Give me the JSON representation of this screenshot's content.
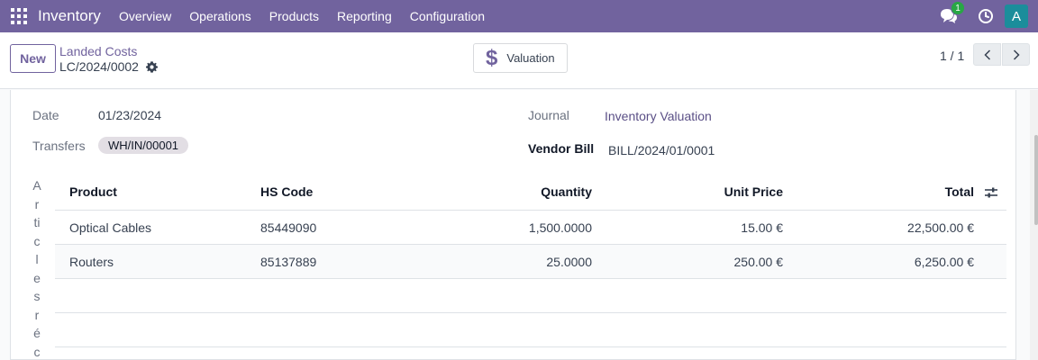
{
  "navbar": {
    "app_name": "Inventory",
    "menu": [
      "Overview",
      "Operations",
      "Products",
      "Reporting",
      "Configuration"
    ],
    "chat_badge": "1",
    "avatar_letter": "A"
  },
  "control_panel": {
    "new_label": "New",
    "breadcrumb_parent": "Landed Costs",
    "breadcrumb_current": "LC/2024/0002",
    "valuation_label": "Valuation",
    "pager": "1 / 1"
  },
  "form": {
    "date_label": "Date",
    "date_value": "01/23/2024",
    "transfers_label": "Transfers",
    "transfers_tag": "WH/IN/00001",
    "journal_label": "Journal",
    "journal_value": "Inventory Valuation",
    "vendor_bill_label": "Vendor Bill",
    "vendor_bill_value": "BILL/2024/01/0001",
    "vertical_label_chars": [
      "A",
      "r",
      "ti",
      "c",
      "l",
      "e",
      "s",
      "r",
      "é",
      "c"
    ]
  },
  "table": {
    "headers": {
      "product": "Product",
      "hs_code": "HS Code",
      "quantity": "Quantity",
      "unit_price": "Unit Price",
      "total": "Total"
    },
    "rows": [
      {
        "product": "Optical Cables",
        "hs_code": "85449090",
        "quantity": "1,500.0000",
        "unit_price": "15.00 €",
        "total": "22,500.00 €"
      },
      {
        "product": "Routers",
        "hs_code": "85137889",
        "quantity": "25.0000",
        "unit_price": "250.00 €",
        "total": "6,250.00 €"
      }
    ]
  },
  "colors": {
    "brand": "#71639e",
    "badge_green": "#28a745",
    "avatar": "#1b8d9b"
  }
}
